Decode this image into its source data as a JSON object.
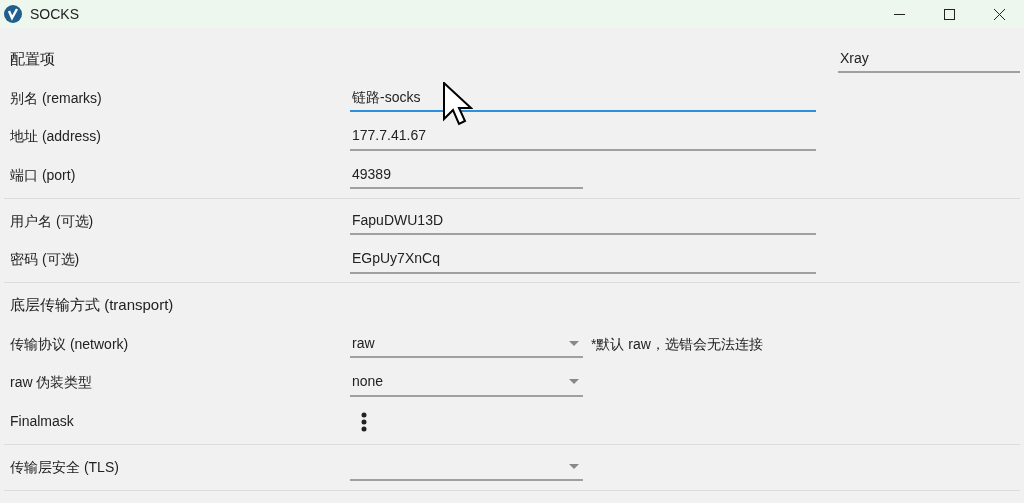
{
  "window": {
    "title": "SOCKS"
  },
  "sections": [
    {
      "heading": "配置项",
      "core_field": {
        "value": "Xray",
        "focused": false
      },
      "rows": [
        {
          "kind": "text",
          "label": "别名 (remarks)",
          "value": "链路-socks",
          "focused": true
        },
        {
          "kind": "text",
          "label": "地址 (address)",
          "value": "177.7.41.67",
          "focused": false
        },
        {
          "kind": "short_text",
          "label": "端口 (port)",
          "value": "49389",
          "focused": false
        }
      ]
    },
    {
      "rows": [
        {
          "kind": "text",
          "label": "用户名 (可选)",
          "value": "FapuDWU13D",
          "focused": false
        },
        {
          "kind": "text",
          "label": "密码 (可选)",
          "value": "EGpUy7XnCq",
          "focused": false
        }
      ]
    },
    {
      "heading": "底层传输方式 (transport)",
      "rows": [
        {
          "kind": "select",
          "label": "传输协议 (network)",
          "value": "raw",
          "note": "*默认 raw，选错会无法连接"
        },
        {
          "kind": "select",
          "label": "raw 伪装类型",
          "value": "none"
        },
        {
          "kind": "menu",
          "label": "Finalmask"
        }
      ]
    },
    {
      "rows": [
        {
          "kind": "select",
          "label": "传输层安全 (TLS)"
        }
      ]
    }
  ]
}
